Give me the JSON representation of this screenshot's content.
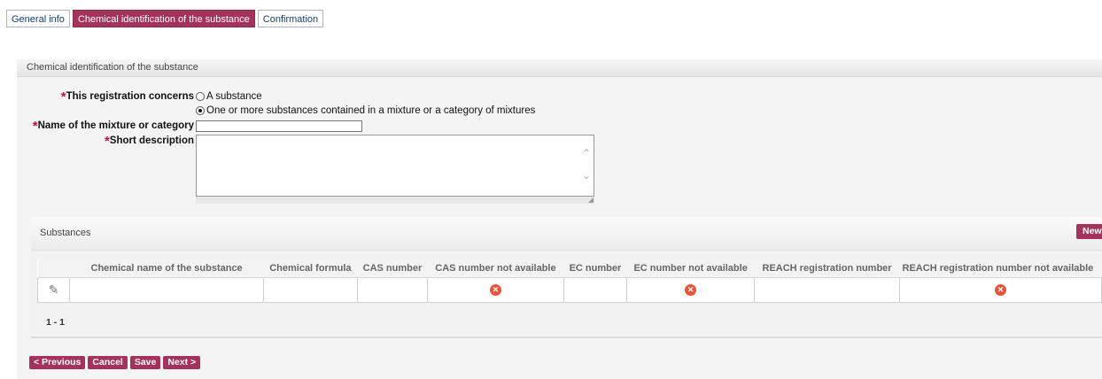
{
  "tabs": [
    {
      "label": "General info"
    },
    {
      "label": "Chemical identification of the substance"
    },
    {
      "label": "Confirmation"
    }
  ],
  "panel": {
    "title": "Chemical identification of the substance"
  },
  "form": {
    "registration_label": "This registration concerns",
    "required_marker": "*",
    "option_substance": "A substance",
    "option_mixture": "One or more substances contained in a mixture or a category of mixtures",
    "selected_option": "One or more substances contained in a mixture or a category of mixtures",
    "name_label": "Name of the mixture or category",
    "name_value": "",
    "description_label": "Short description",
    "description_value": ""
  },
  "substances": {
    "title": "Substances",
    "new_button": "New",
    "columns": [
      "",
      "Chemical name of the substance",
      "Chemical formula",
      "CAS number",
      "CAS number not available",
      "EC number",
      "EC number not available",
      "REACH registration number",
      "REACH registration number not available"
    ],
    "rows": [
      {
        "chemical_name": "",
        "chemical_formula": "",
        "cas_number": "",
        "cas_not_available": "no",
        "ec_number": "",
        "ec_not_available": "no",
        "reach_number": "",
        "reach_not_available": "no"
      }
    ],
    "pager": "1 - 1"
  },
  "buttons": {
    "previous": "< Previous",
    "cancel": "Cancel",
    "save": "Save",
    "next": "Next >"
  },
  "icons": {
    "edit": "edit-icon",
    "not_available": "x-circle-icon"
  },
  "colors": {
    "accent": "#a5325b",
    "required": "#c0143c",
    "error_icon": "#e8533a"
  }
}
